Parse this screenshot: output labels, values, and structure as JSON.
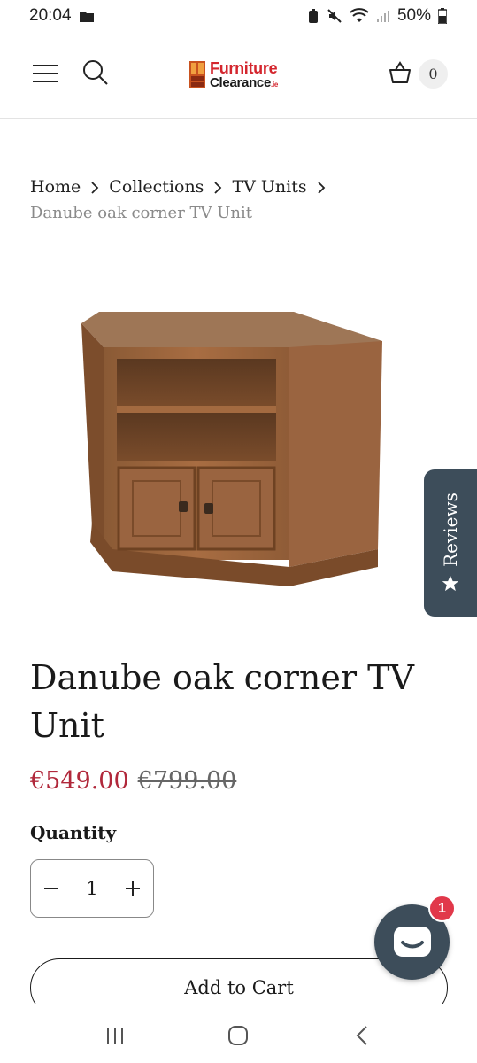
{
  "status_bar": {
    "time": "20:04",
    "battery": "50%"
  },
  "header": {
    "logo_line1": "Furniture",
    "logo_line2": "Clearance",
    "logo_tld": ".ie",
    "cart_count": "0"
  },
  "breadcrumb": {
    "items": [
      "Home",
      "Collections",
      "TV Units"
    ],
    "current": "Danube oak corner TV Unit"
  },
  "reviews_tab": {
    "label": "Reviews"
  },
  "product": {
    "title": "Danube oak corner TV Unit",
    "sale_price": "€549.00",
    "compare_price": "€799.00"
  },
  "quantity": {
    "label": "Quantity",
    "value": "1"
  },
  "add_to_cart": {
    "label": "Add to Cart"
  },
  "chat": {
    "badge": "1"
  },
  "colors": {
    "sale": "#b1283b",
    "tab": "#3d4d5a",
    "badge": "#e1384a",
    "logo_red": "#d4262e"
  }
}
